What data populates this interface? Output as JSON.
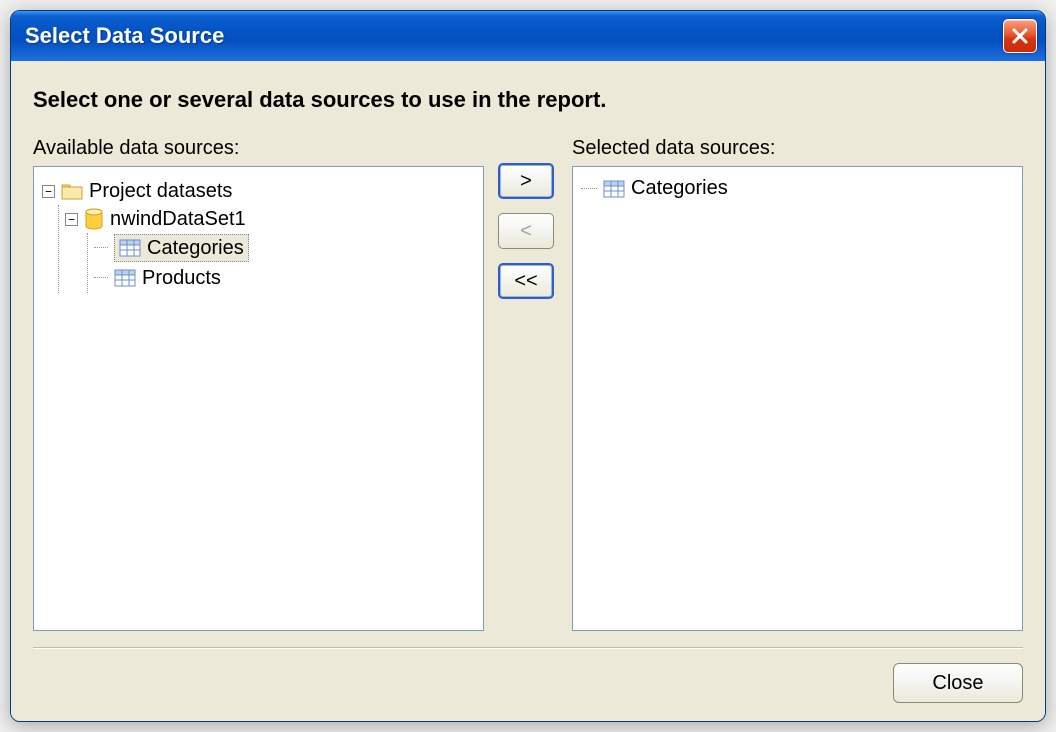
{
  "window": {
    "title": "Select Data Source"
  },
  "instruction": "Select one or several data sources to use in the report.",
  "labels": {
    "available": "Available data sources:",
    "selected": "Selected data sources:"
  },
  "buttons": {
    "add": ">",
    "remove": "<",
    "remove_all": "<<",
    "close": "Close"
  },
  "available_tree": {
    "root": {
      "label": "Project datasets",
      "children": [
        {
          "label": "nwindDataSet1",
          "children": [
            {
              "label": "Categories",
              "selected": true
            },
            {
              "label": "Products",
              "selected": false
            }
          ]
        }
      ]
    }
  },
  "selected_list": [
    {
      "label": "Categories"
    }
  ]
}
